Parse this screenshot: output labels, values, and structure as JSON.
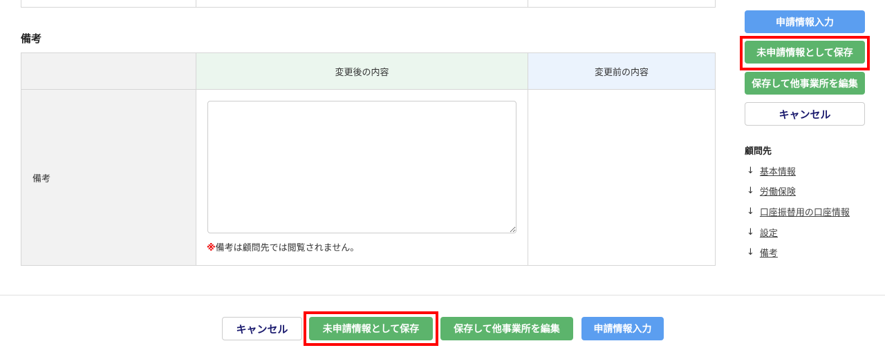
{
  "section_title": "備考",
  "table": {
    "header_after": "変更後の内容",
    "header_before": "変更前の内容",
    "row_label": "備考",
    "textarea_value": "",
    "note_mark": "※",
    "note": "備考は顧問先では閲覧されません。",
    "before_value": ""
  },
  "side": {
    "apply": "申請情報入力",
    "save_unapplied": "未申請情報として保存",
    "save_edit_other": "保存して他事業所を編集",
    "cancel": "キャンセル",
    "nav_title": "顧問先",
    "nav": [
      "基本情報",
      "労働保険",
      "口座振替用の口座情報",
      "設定",
      "備考"
    ]
  },
  "footer": {
    "cancel": "キャンセル",
    "save_unapplied": "未申請情報として保存",
    "save_edit_other": "保存して他事業所を編集",
    "apply": "申請情報入力"
  },
  "colors": {
    "green": "#5cb46c",
    "blue": "#5b9ef0",
    "highlight": "#ff0000"
  }
}
